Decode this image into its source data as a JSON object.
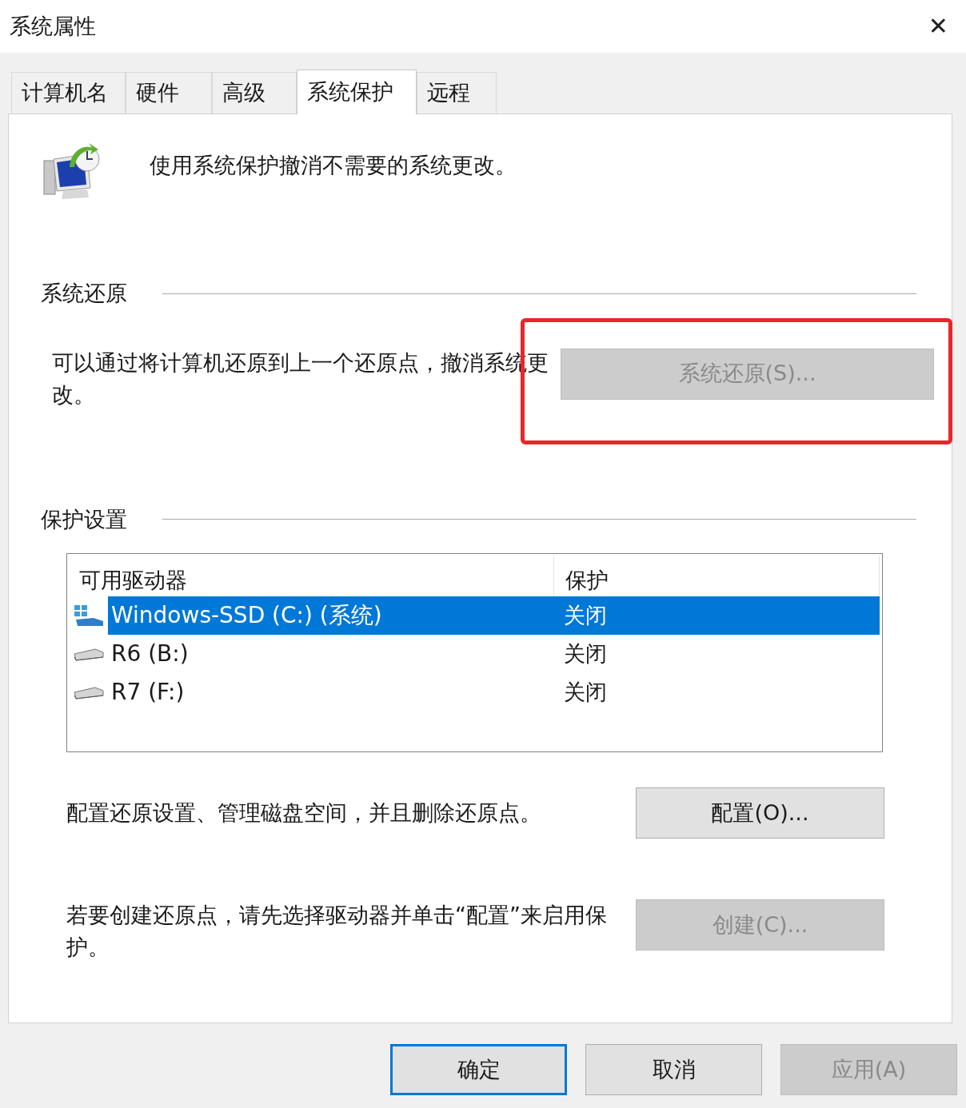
{
  "window": {
    "title": "系统属性",
    "close": "✕"
  },
  "tabs": [
    {
      "label": "计算机名",
      "selected": false
    },
    {
      "label": "硬件",
      "selected": false
    },
    {
      "label": "高级",
      "selected": false
    },
    {
      "label": "系统保护",
      "selected": true
    },
    {
      "label": "远程",
      "selected": false
    }
  ],
  "intro": "使用系统保护撤消不需要的系统更改。",
  "restore": {
    "heading": "系统还原",
    "text": "可以通过将计算机还原到上一个还原点，撤消系统更改。",
    "button": {
      "label": "系统还原(S)...",
      "disabled": true
    },
    "highlighted": true
  },
  "protection": {
    "heading": "保护设置",
    "columns": [
      "可用驱动器",
      "保护"
    ],
    "rows": [
      {
        "drive": "Windows-SSD (C:) (系统)",
        "kind": "system",
        "protection": "关闭",
        "selected": true
      },
      {
        "drive": "R6 (B:)",
        "kind": "disk",
        "protection": "关闭",
        "selected": false
      },
      {
        "drive": "R7 (F:)",
        "kind": "disk",
        "protection": "关闭",
        "selected": false
      }
    ],
    "configure_text": "配置还原设置、管理磁盘空间，并且删除还原点。",
    "configure_button": {
      "label": "配置(O)...",
      "disabled": false
    },
    "create_text": "若要创建还原点，请先选择驱动器并单击“配置”来启用保护。",
    "create_button": {
      "label": "创建(C)...",
      "disabled": true
    }
  },
  "buttons": [
    {
      "label": "确定",
      "default": true,
      "disabled": false
    },
    {
      "label": "取消",
      "default": false,
      "disabled": false
    },
    {
      "label": "应用(A)",
      "default": false,
      "disabled": true
    }
  ]
}
